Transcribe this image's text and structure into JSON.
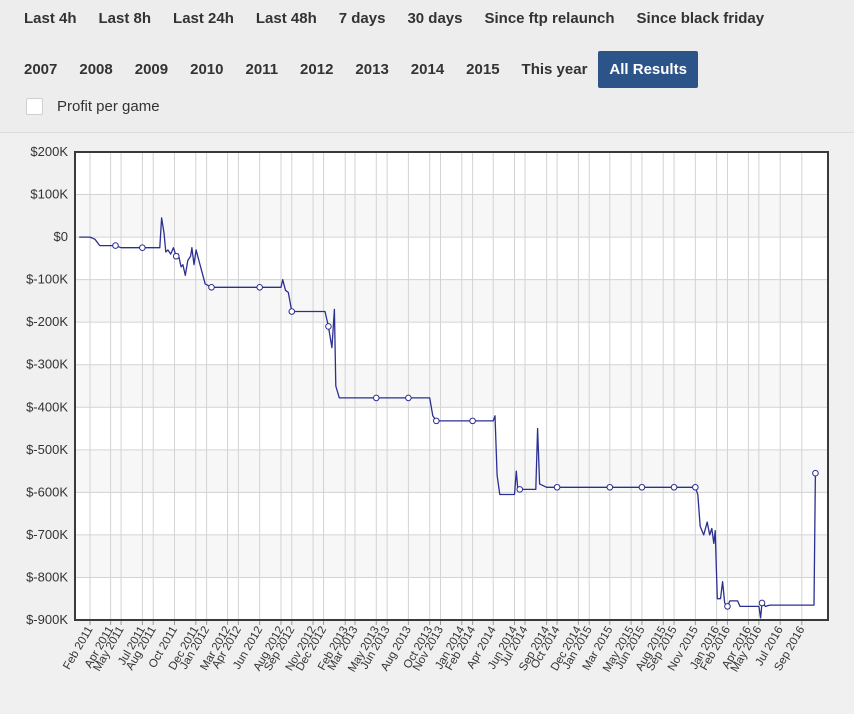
{
  "toolbar": {
    "row1": [
      "Last 4h",
      "Last 8h",
      "Last 24h",
      "Last 48h",
      "7 days",
      "30 days",
      "Since ftp relaunch",
      "Since black friday"
    ],
    "row2": [
      "2007",
      "2008",
      "2009",
      "2010",
      "2011",
      "2012",
      "2013",
      "2014",
      "2015",
      "This year",
      "All Results"
    ],
    "active": "All Results",
    "active_color": "#2c5488"
  },
  "options": {
    "profit_per_game_label": "Profit per game",
    "profit_per_game_checked": false
  },
  "chart_data": {
    "type": "line",
    "line_color": "#2b2f91",
    "grid": true,
    "ylim": [
      -900000,
      200000
    ],
    "y_ticks": [
      200000,
      100000,
      0,
      -100000,
      -200000,
      -300000,
      -400000,
      -500000,
      -600000,
      -700000,
      -800000,
      -900000
    ],
    "y_tick_labels": [
      "$200K",
      "$100K",
      "$0",
      "$-100K",
      "$-200K",
      "$-300K",
      "$-400K",
      "$-500K",
      "$-600K",
      "$-700K",
      "$-800K",
      "$-900K"
    ],
    "xlim": [
      "2010-12-20",
      "2016-11-15"
    ],
    "x_ticks": [
      "2011-02-01",
      "2011-04-01",
      "2011-05-01",
      "2011-07-01",
      "2011-08-01",
      "2011-10-01",
      "2011-12-01",
      "2012-01-01",
      "2012-03-01",
      "2012-04-01",
      "2012-06-01",
      "2012-08-01",
      "2012-09-01",
      "2012-11-01",
      "2012-12-01",
      "2013-02-01",
      "2013-03-01",
      "2013-05-01",
      "2013-06-01",
      "2013-08-01",
      "2013-10-01",
      "2013-11-01",
      "2014-01-01",
      "2014-02-01",
      "2014-04-01",
      "2014-06-01",
      "2014-07-01",
      "2014-09-01",
      "2014-10-01",
      "2014-12-01",
      "2015-01-01",
      "2015-03-01",
      "2015-05-01",
      "2015-06-01",
      "2015-08-01",
      "2015-09-01",
      "2015-11-01",
      "2016-01-01",
      "2016-02-01",
      "2016-04-01",
      "2016-05-01",
      "2016-07-01",
      "2016-09-01"
    ],
    "x_tick_labels": [
      "Feb 2011",
      "Apr 2011",
      "May 2011",
      "Jul 2011",
      "Aug 2011",
      "Oct 2011",
      "Dec 2011",
      "Jan 2012",
      "Mar 2012",
      "Apr 2012",
      "Jun 2012",
      "Aug 2012",
      "Sep 2012",
      "Nov 2012",
      "Dec 2012",
      "Feb 2013",
      "Mar 2013",
      "May 2013",
      "Jun 2013",
      "Aug 2013",
      "Oct 2013",
      "Nov 2013",
      "Jan 2014",
      "Feb 2014",
      "Apr 2014",
      "Jun 2014",
      "Jul 2014",
      "Sep 2014",
      "Oct 2014",
      "Dec 2014",
      "Jan 2015",
      "Mar 2015",
      "May 2015",
      "Jun 2015",
      "Aug 2015",
      "Sep 2015",
      "Nov 2015",
      "Jan 2016",
      "Feb 2016",
      "Apr 2016",
      "May 2016",
      "Jul 2016",
      "Sep 2016"
    ],
    "points": [
      [
        "2011-01-01",
        0
      ],
      [
        "2011-02-01",
        0
      ],
      [
        "2011-02-15",
        -5000
      ],
      [
        "2011-03-01",
        -20000
      ],
      [
        "2011-04-01",
        -20000
      ],
      [
        "2011-04-15",
        -20000
      ],
      [
        "2011-05-01",
        -25000
      ],
      [
        "2011-07-01",
        -25000
      ],
      [
        "2011-08-20",
        -25000
      ],
      [
        "2011-08-25",
        45000
      ],
      [
        "2011-09-01",
        10000
      ],
      [
        "2011-09-06",
        -35000
      ],
      [
        "2011-09-12",
        -30000
      ],
      [
        "2011-09-20",
        -40000
      ],
      [
        "2011-09-28",
        -25000
      ],
      [
        "2011-10-06",
        -45000
      ],
      [
        "2011-10-12",
        -40000
      ],
      [
        "2011-10-20",
        -70000
      ],
      [
        "2011-10-25",
        -65000
      ],
      [
        "2011-11-01",
        -90000
      ],
      [
        "2011-11-08",
        -55000
      ],
      [
        "2011-11-16",
        -45000
      ],
      [
        "2011-11-20",
        -25000
      ],
      [
        "2011-11-26",
        -65000
      ],
      [
        "2011-12-02",
        -30000
      ],
      [
        "2011-12-10",
        -55000
      ],
      [
        "2011-12-18",
        -80000
      ],
      [
        "2011-12-28",
        -110000
      ],
      [
        "2012-01-15",
        -118000
      ],
      [
        "2012-06-01",
        -118000
      ],
      [
        "2012-08-01",
        -118000
      ],
      [
        "2012-08-06",
        -100000
      ],
      [
        "2012-08-14",
        -125000
      ],
      [
        "2012-08-22",
        -130000
      ],
      [
        "2012-09-01",
        -175000
      ],
      [
        "2012-12-05",
        -175000
      ],
      [
        "2012-12-15",
        -210000
      ],
      [
        "2012-12-25",
        -260000
      ],
      [
        "2013-01-01",
        -170000
      ],
      [
        "2013-01-05",
        -350000
      ],
      [
        "2013-01-15",
        -378000
      ],
      [
        "2013-10-01",
        -378000
      ],
      [
        "2013-10-10",
        -420000
      ],
      [
        "2013-10-20",
        -432000
      ],
      [
        "2014-04-01",
        -432000
      ],
      [
        "2014-04-06",
        -420000
      ],
      [
        "2014-04-12",
        -560000
      ],
      [
        "2014-04-20",
        -605000
      ],
      [
        "2014-06-01",
        -605000
      ],
      [
        "2014-06-06",
        -550000
      ],
      [
        "2014-06-10",
        -590000
      ],
      [
        "2014-06-16",
        -593000
      ],
      [
        "2014-08-01",
        -593000
      ],
      [
        "2014-08-06",
        -450000
      ],
      [
        "2014-08-12",
        -580000
      ],
      [
        "2014-09-01",
        -588000
      ],
      [
        "2015-11-01",
        -588000
      ],
      [
        "2015-11-08",
        -605000
      ],
      [
        "2015-11-15",
        -680000
      ],
      [
        "2015-11-25",
        -700000
      ],
      [
        "2015-12-05",
        -670000
      ],
      [
        "2015-12-12",
        -700000
      ],
      [
        "2015-12-18",
        -685000
      ],
      [
        "2015-12-24",
        -720000
      ],
      [
        "2015-12-28",
        -690000
      ],
      [
        "2016-01-03",
        -850000
      ],
      [
        "2016-01-12",
        -850000
      ],
      [
        "2016-01-18",
        -810000
      ],
      [
        "2016-01-24",
        -860000
      ],
      [
        "2016-02-01",
        -868000
      ],
      [
        "2016-02-08",
        -855000
      ],
      [
        "2016-03-01",
        -855000
      ],
      [
        "2016-03-08",
        -868000
      ],
      [
        "2016-05-01",
        -868000
      ],
      [
        "2016-05-06",
        -895000
      ],
      [
        "2016-05-10",
        -860000
      ],
      [
        "2016-05-20",
        -868000
      ],
      [
        "2016-06-01",
        -865000
      ],
      [
        "2016-10-06",
        -865000
      ],
      [
        "2016-10-10",
        -555000
      ]
    ],
    "markers": [
      [
        "2011-04-15",
        -20000
      ],
      [
        "2011-07-01",
        -25000
      ],
      [
        "2011-10-06",
        -45000
      ],
      [
        "2012-01-15",
        -118000
      ],
      [
        "2012-06-01",
        -118000
      ],
      [
        "2012-09-01",
        -175000
      ],
      [
        "2012-12-15",
        -210000
      ],
      [
        "2013-05-01",
        -378000
      ],
      [
        "2013-08-01",
        -378000
      ],
      [
        "2013-10-20",
        -432000
      ],
      [
        "2014-02-01",
        -432000
      ],
      [
        "2014-06-16",
        -593000
      ],
      [
        "2014-10-01",
        -588000
      ],
      [
        "2015-03-01",
        -588000
      ],
      [
        "2015-06-01",
        -588000
      ],
      [
        "2015-09-01",
        -588000
      ],
      [
        "2015-11-01",
        -588000
      ],
      [
        "2016-02-01",
        -868000
      ],
      [
        "2016-05-10",
        -860000
      ],
      [
        "2016-10-10",
        -555000
      ]
    ]
  }
}
